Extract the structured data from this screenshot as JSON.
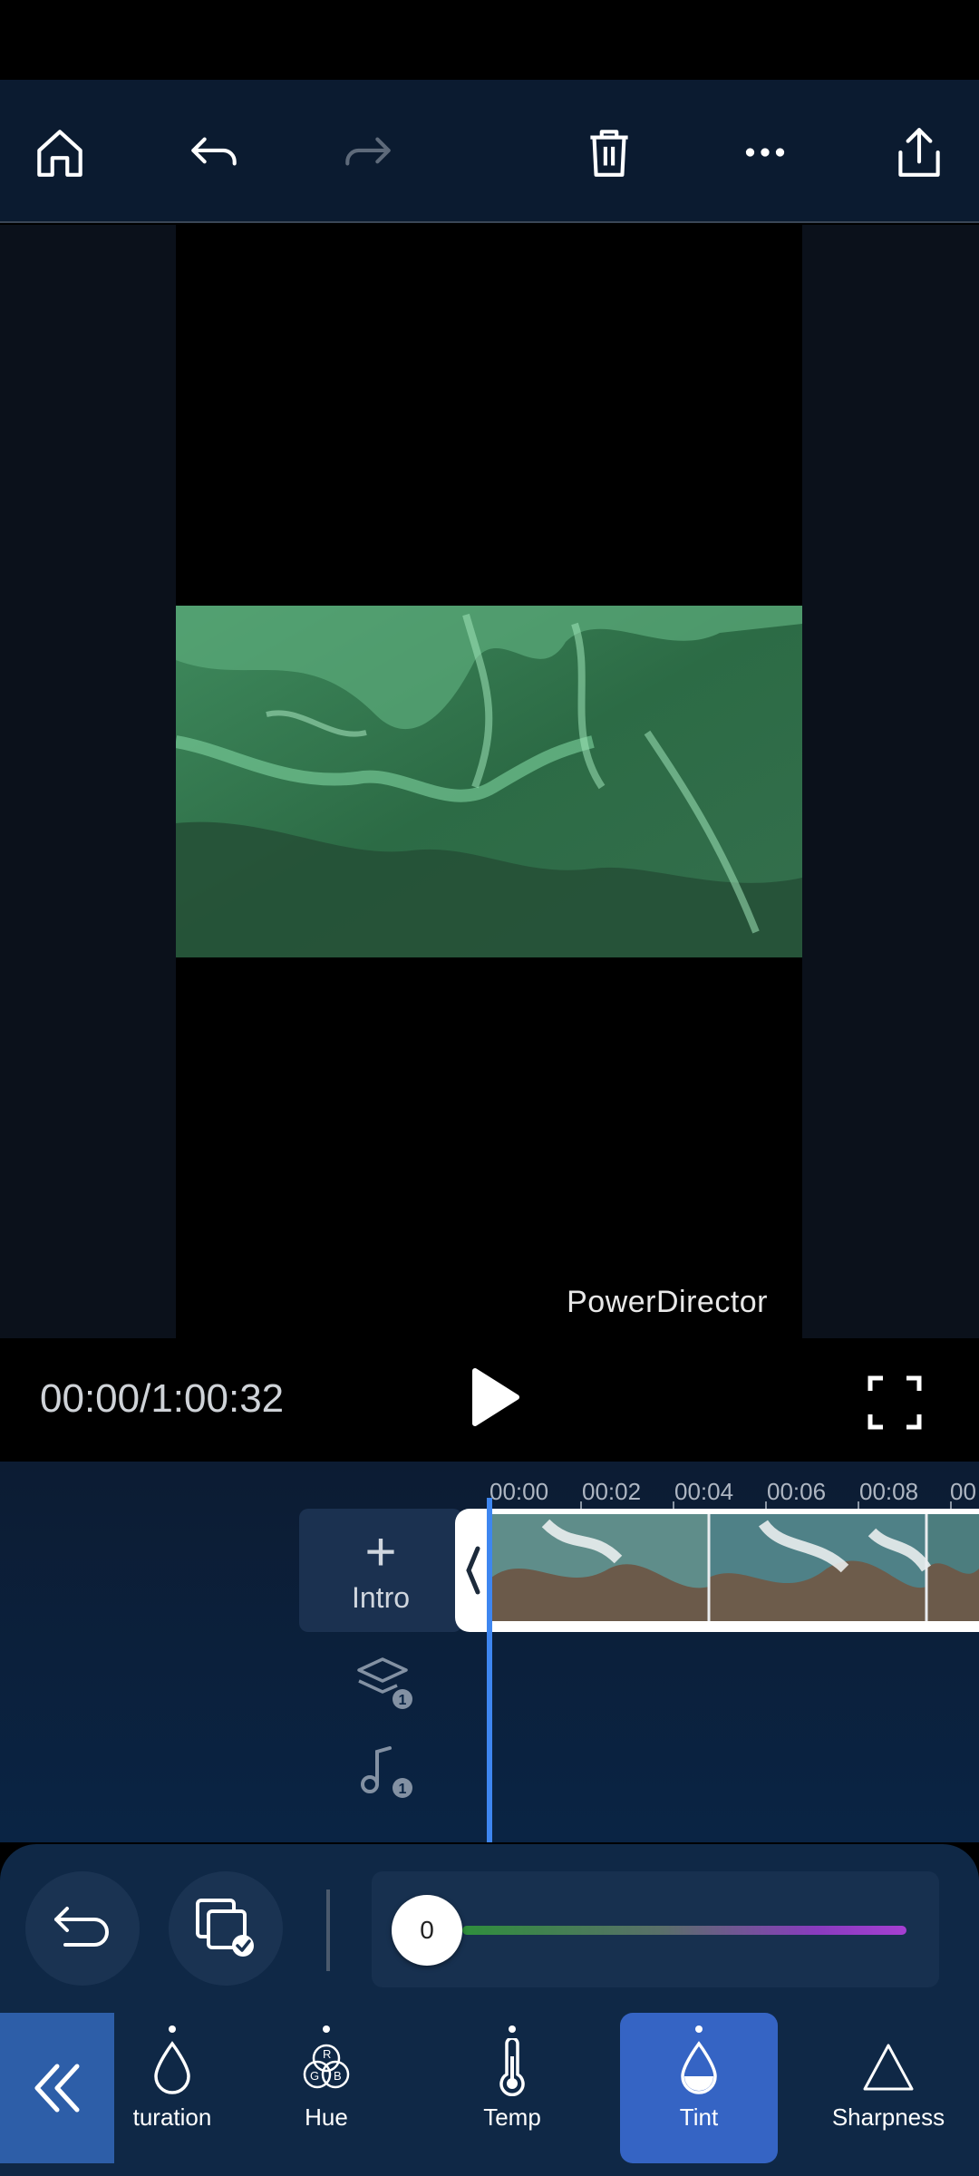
{
  "toolbar": {
    "buttons": [
      "home",
      "undo",
      "redo",
      "delete",
      "more",
      "export"
    ]
  },
  "preview": {
    "watermark": "PowerDirector"
  },
  "transport": {
    "timecode": "00:00/1:00:32"
  },
  "timeline": {
    "ruler_labels": [
      "00:00",
      "00:02",
      "00:04",
      "00:06",
      "00:08",
      "00"
    ],
    "intro_label": "Intro",
    "overlay_count": "1",
    "audio_count": "1"
  },
  "edit_panel": {
    "slider_value": "0",
    "adjustments": [
      {
        "label": "turation",
        "icon": "droplet-icon"
      },
      {
        "label": "Hue",
        "icon": "rgb-icon"
      },
      {
        "label": "Temp",
        "icon": "thermometer-icon"
      },
      {
        "label": "Tint",
        "icon": "tint-icon",
        "active": true
      },
      {
        "label": "Sharpness",
        "icon": "triangle-icon"
      }
    ]
  },
  "colors": {
    "accent": "#3564c4",
    "playhead": "#3e86f0",
    "toolbar_bg": "#0b1b30"
  }
}
